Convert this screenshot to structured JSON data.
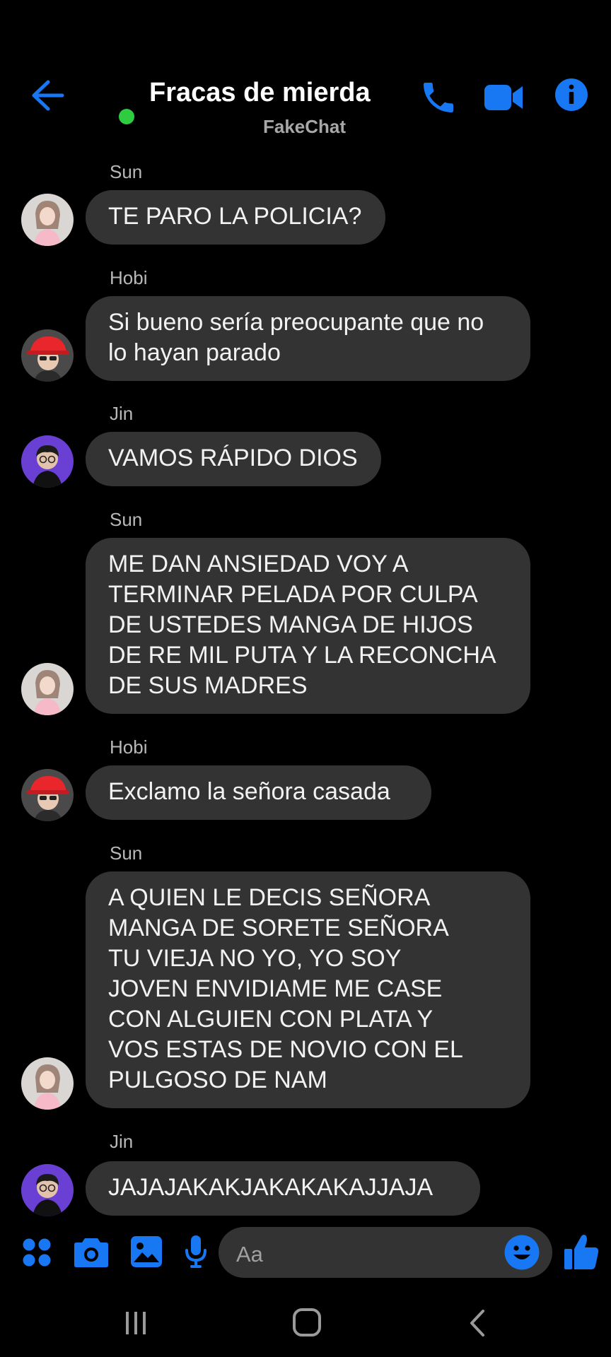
{
  "header": {
    "title": "Fracas de mierda",
    "subtitle": "FakeChat",
    "online_color": "#2ecc40",
    "icons": [
      "back-arrow-icon",
      "phone-icon",
      "video-call-icon",
      "info-icon"
    ]
  },
  "accent_color": "#1877f2",
  "messages": [
    {
      "sender": "Sun",
      "text": "TE PARO LA POLICIA?"
    },
    {
      "sender": "Hobi",
      "text": "Si bueno sería preocupante que no\nlo hayan parado"
    },
    {
      "sender": "Jin",
      "text": "VAMOS RÁPIDO DIOS"
    },
    {
      "sender": "Sun",
      "text": "ME DAN ANSIEDAD VOY A\nTERMINAR PELADA POR CULPA\nDE USTEDES MANGA DE HIJOS\nDE RE MIL PUTA Y LA RECONCHA\nDE SUS MADRES"
    },
    {
      "sender": "Hobi",
      "text": "Exclamo la señora casada"
    },
    {
      "sender": "Sun",
      "text": "A QUIEN LE DECIS SEÑORA\nMANGA DE SORETE SEÑORA\nTU VIEJA NO YO, YO SOY\nJOVEN ENVIDIAME ME CASE\nCON ALGUIEN CON PLATA Y\nVOS ESTAS DE NOVIO CON EL\nPULGOSO DE NAM"
    },
    {
      "sender": "Jin",
      "text": "JAJAJAKAKJAKAKAKAJJAJA"
    }
  ],
  "composer": {
    "placeholder": "Aa",
    "icons": [
      "apps-icon",
      "camera-icon",
      "gallery-icon",
      "microphone-icon",
      "emoji-icon",
      "thumbs-up-icon"
    ]
  },
  "navbar": {
    "icons": [
      "recent-apps-icon",
      "home-icon",
      "back-icon"
    ]
  }
}
